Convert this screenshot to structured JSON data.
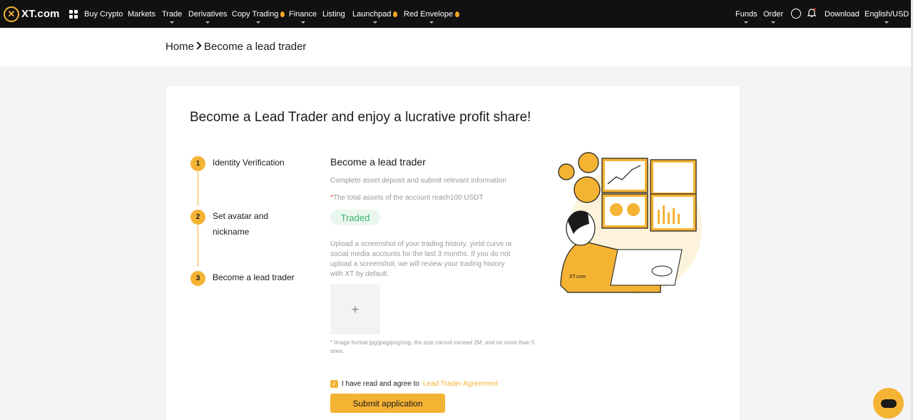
{
  "nav": {
    "logo_text": "XT.com",
    "items": [
      {
        "label": "Buy Crypto",
        "hot": false
      },
      {
        "label": "Markets",
        "hot": false
      },
      {
        "label": "Trade",
        "hot": false
      },
      {
        "label": "Derivatives",
        "hot": false
      },
      {
        "label": "Copy Trading",
        "hot": true
      },
      {
        "label": "Finance",
        "hot": false
      },
      {
        "label": "Listing",
        "hot": false
      },
      {
        "label": "Launchpad",
        "hot": true
      },
      {
        "label": "Red Envelope",
        "hot": true
      }
    ],
    "right": {
      "funds": "Funds",
      "order": "Order",
      "download": "Download",
      "locale": "English/USD"
    }
  },
  "breadcrumb": {
    "home": "Home",
    "current": "Become a lead trader"
  },
  "page": {
    "headline": "Become a Lead Trader and enjoy a lucrative profit share!",
    "steps": [
      {
        "num": "1",
        "label": "Identity Verification"
      },
      {
        "num": "2",
        "label_line1": "Set avatar and",
        "label_line2": "nickname"
      },
      {
        "num": "3",
        "label": "Become a lead trader"
      }
    ],
    "form": {
      "title": "Become a lead trader",
      "subtitle": "Complete asset deposit and submit relevant information",
      "requirement_mark": "*",
      "requirement": "The total assets of the account reach100 USDT",
      "status_badge": "Traded",
      "upload_hint_lines": [
        "Upload a screenshot of your trading history, yield curve or",
        "social media accounts for the last 3 months. If you do not",
        "upload a screenshot, we will review your trading history",
        "with XT by default."
      ],
      "upload_plus": "+",
      "format_note": "* Image format jpg/jpeg/png/svg, the size cannot exceed 2M, and no more than 5 ones.",
      "agree_text": "I have read and agree to",
      "agree_link": "Lead Trader Agreement",
      "submit_label": "Submit application"
    }
  },
  "illustration": {
    "logo_text": "XT.com"
  },
  "colors": {
    "accent": "#f5b334",
    "nav_bg": "#111111",
    "success": "#3cb46e"
  }
}
